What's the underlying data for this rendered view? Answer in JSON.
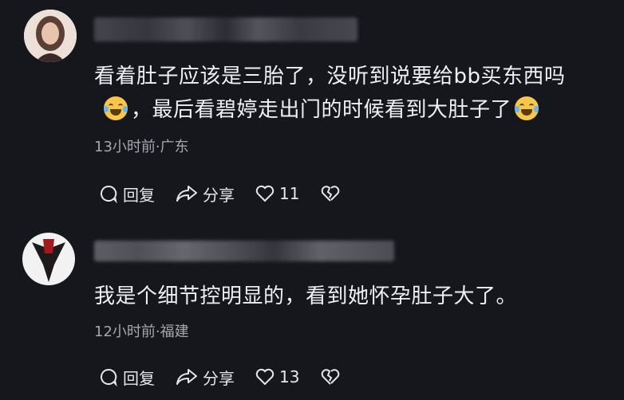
{
  "comments": [
    {
      "text_line1": "看着肚子应该是三胎了，没听到说要给bb买东西吗",
      "text_line2": "，最后看碧婷走出门的时候看到大肚子了",
      "meta": "13小时前·广东",
      "reply_label": "回复",
      "share_label": "分享",
      "like_count": "11",
      "emoji_before": "laughing-tears-emoji",
      "emoji_after": "laughing-tears-emoji"
    },
    {
      "text_line1": "我是个细节控明显的，看到她怀孕肚子大了。",
      "meta": "12小时前·福建",
      "reply_label": "回复",
      "share_label": "分享",
      "like_count": "13"
    }
  ],
  "colors": {
    "background": "#16171d",
    "text": "#eef0f3",
    "meta": "#a4a7ae"
  }
}
